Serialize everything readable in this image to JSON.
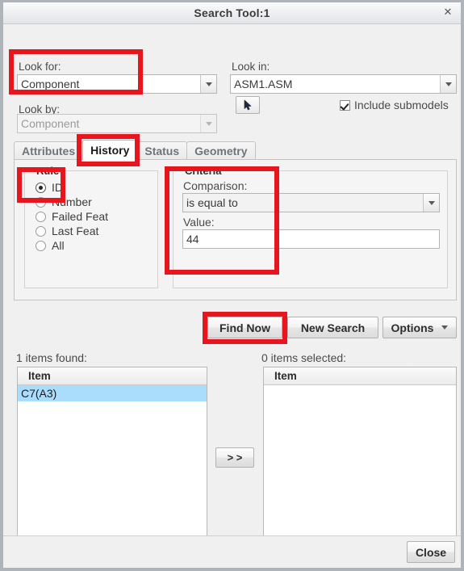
{
  "window": {
    "title": "Search Tool:1",
    "close_icon": "close-x-icon"
  },
  "look_for": {
    "label": "Look for:",
    "value": "Component",
    "dropdown_icon": "chevron-down-icon"
  },
  "look_in": {
    "label": "Look in:",
    "value": "ASM1.ASM",
    "dropdown_icon": "chevron-down-icon"
  },
  "look_by": {
    "label": "Look by:",
    "value": "Component",
    "dropdown_icon": "chevron-down-icon",
    "disabled": true
  },
  "pick_button": {
    "icon": "mouse-pointer-icon"
  },
  "include_submodels": {
    "label": "Include submodels",
    "checked": true
  },
  "tabs": [
    {
      "label": "Attributes",
      "active": false
    },
    {
      "label": "History",
      "active": true
    },
    {
      "label": "Status",
      "active": false
    },
    {
      "label": "Geometry",
      "active": false
    }
  ],
  "rule_group": {
    "title": "Rule",
    "options": [
      {
        "label": "ID",
        "selected": true
      },
      {
        "label": "Number",
        "selected": false
      },
      {
        "label": "Failed Feat",
        "selected": false
      },
      {
        "label": "Last Feat",
        "selected": false
      },
      {
        "label": "All",
        "selected": false
      }
    ]
  },
  "criteria_group": {
    "title": "Criteria",
    "comparison_label": "Comparison:",
    "comparison_value": "is equal to",
    "comparison_dropdown_icon": "chevron-down-icon",
    "value_label": "Value:",
    "value": "44"
  },
  "action_buttons": {
    "find_now": "Find Now",
    "new_search": "New Search",
    "options": "Options",
    "options_dropdown_icon": "chevron-down-icon"
  },
  "results": {
    "found_label": "1 items found:",
    "found_column": "Item",
    "found_rows": [
      {
        "label": "C7(A3)",
        "selected": true
      }
    ],
    "selected_label": "0 items selected:",
    "selected_column": "Item",
    "selected_rows": [],
    "transfer_button": "> >"
  },
  "footer": {
    "close_label": "Close"
  },
  "annotations": {
    "accent_color": "#e8141e",
    "boxes": [
      "look-for-highlight",
      "history-tab-highlight",
      "rule-id-highlight",
      "criteria-highlight",
      "find-now-highlight"
    ]
  }
}
